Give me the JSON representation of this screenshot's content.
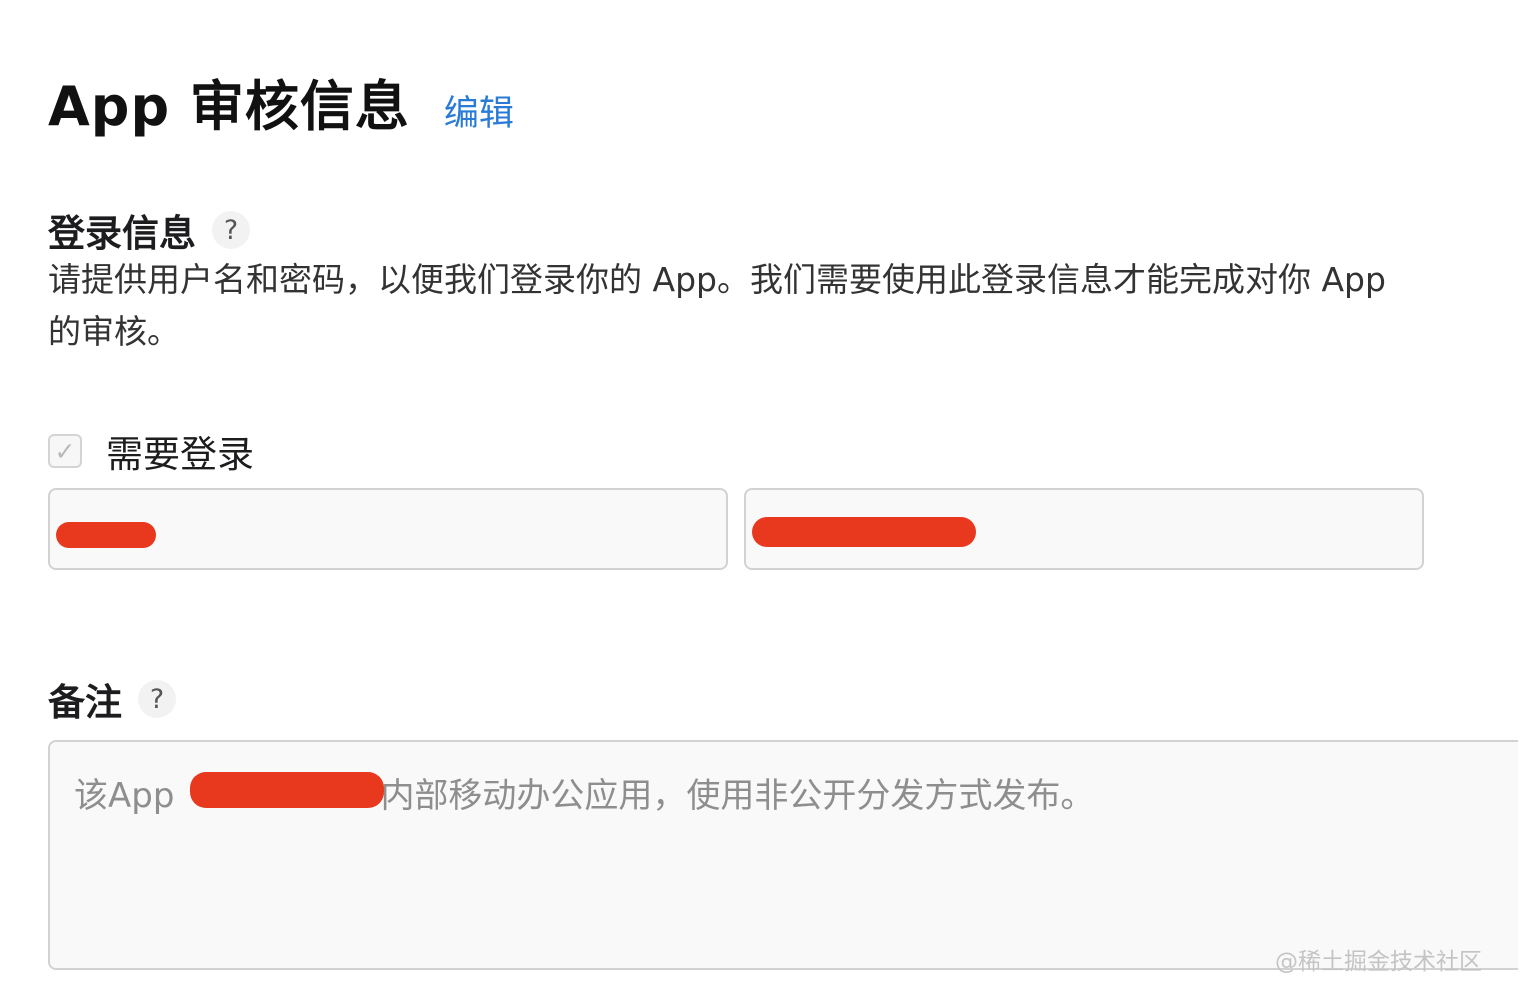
{
  "header": {
    "title": "App 审核信息",
    "edit_label": "编辑"
  },
  "login_section": {
    "heading": "登录信息",
    "help_symbol": "?",
    "description": "请提供用户名和密码，以便我们登录你的 App。我们需要使用此登录信息才能完成对你 App 的审核。",
    "requires_login_label": "需要登录",
    "requires_login_checked": true,
    "checkmark_symbol": "✓",
    "redaction_color": "#e8391f"
  },
  "notes_section": {
    "heading": "备注",
    "help_symbol": "?",
    "text_before_redaction": "该App",
    "text_after_redaction": "内部移动办公应用，使用非公开分发方式发布。"
  },
  "watermark": "@稀土掘金技术社区",
  "colors": {
    "link": "#2a7bd6",
    "field_border": "#d2d2d2",
    "field_background": "#f9f9f9",
    "redaction": "#e8391f"
  }
}
